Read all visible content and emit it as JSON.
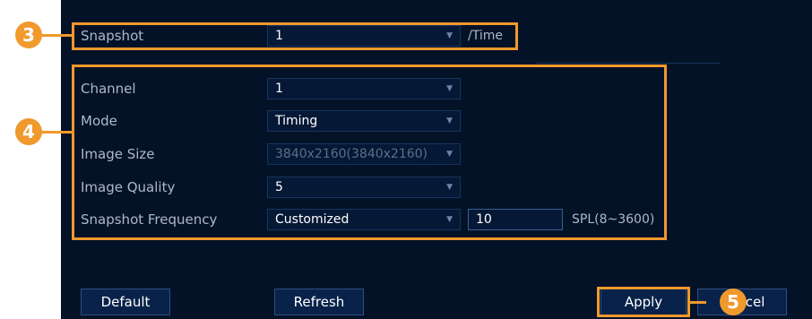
{
  "snapshot": {
    "label": "Snapshot",
    "value": "1",
    "unit": "/Time"
  },
  "fields": {
    "channel": {
      "label": "Channel",
      "value": "1"
    },
    "mode": {
      "label": "Mode",
      "value": "Timing"
    },
    "image_size": {
      "label": "Image Size",
      "value": "3840x2160(3840x2160)"
    },
    "image_quality": {
      "label": "Image Quality",
      "value": "5"
    },
    "snapshot_frequency": {
      "label": "Snapshot Frequency",
      "value": "Customized",
      "input_value": "10",
      "range": "SPL(8~3600)"
    }
  },
  "buttons": {
    "default": "Default",
    "refresh": "Refresh",
    "apply": "Apply",
    "cancel": "Cancel"
  },
  "callouts": {
    "c3": "3",
    "c4": "4",
    "c5": "5"
  },
  "colors": {
    "accent": "#f0992d",
    "panel_bg": "#041228",
    "text_muted": "#aeb8c6"
  }
}
